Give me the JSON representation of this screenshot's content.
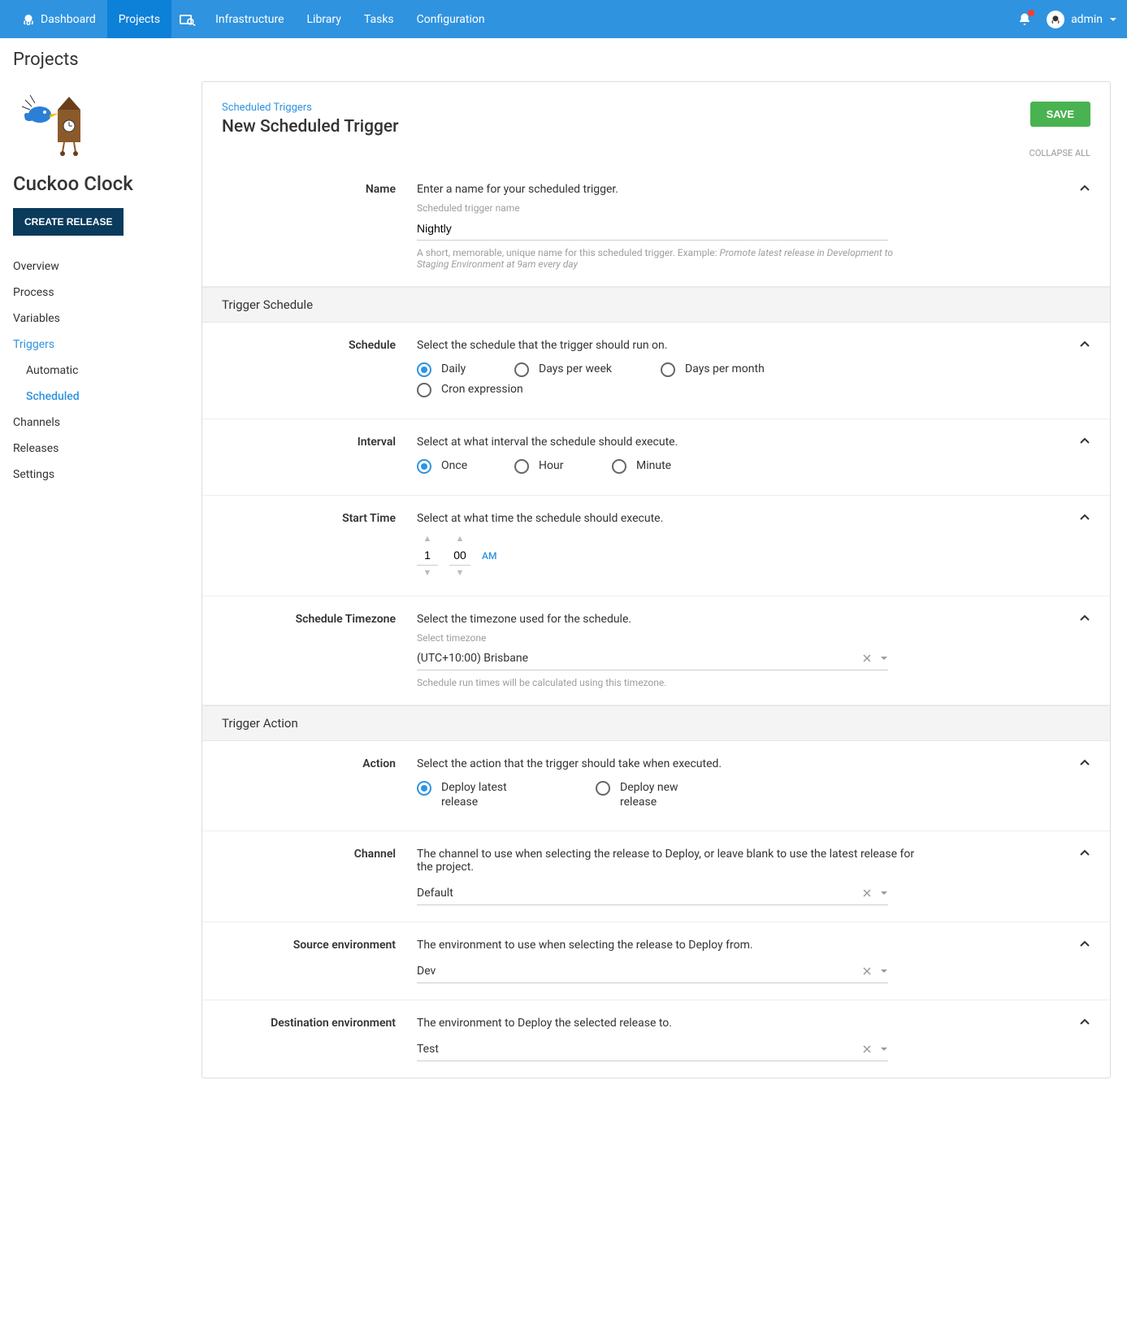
{
  "topnav": {
    "items": [
      "Dashboard",
      "Projects",
      "Infrastructure",
      "Library",
      "Tasks",
      "Configuration"
    ],
    "active": "Projects",
    "user": "admin"
  },
  "page_title": "Projects",
  "project": {
    "name": "Cuckoo Clock",
    "create_release_label": "CREATE RELEASE"
  },
  "sidebar": {
    "items": [
      {
        "label": "Overview"
      },
      {
        "label": "Process"
      },
      {
        "label": "Variables"
      },
      {
        "label": "Triggers",
        "active": true
      },
      {
        "label": "Automatic",
        "sub": true
      },
      {
        "label": "Scheduled",
        "sub": true,
        "active": true
      },
      {
        "label": "Channels"
      },
      {
        "label": "Releases"
      },
      {
        "label": "Settings"
      }
    ]
  },
  "header": {
    "breadcrumb": "Scheduled Triggers",
    "title": "New Scheduled Trigger",
    "save_label": "SAVE",
    "collapse_label": "COLLAPSE ALL"
  },
  "sections": {
    "name": {
      "label": "Name",
      "desc": "Enter a name for your scheduled trigger.",
      "hint": "Scheduled trigger name",
      "value": "Nightly",
      "help_prefix": "A short, memorable, unique name for this scheduled trigger. Example: ",
      "help_example": "Promote latest release in Development to Staging Environment at 9am every day"
    },
    "trigger_schedule_header": "Trigger Schedule",
    "schedule": {
      "label": "Schedule",
      "desc": "Select the schedule that the trigger should run on.",
      "options": [
        "Daily",
        "Days per week",
        "Days per month",
        "Cron expression"
      ],
      "selected": "Daily"
    },
    "interval": {
      "label": "Interval",
      "desc": "Select at what interval the schedule should execute.",
      "options": [
        "Once",
        "Hour",
        "Minute"
      ],
      "selected": "Once"
    },
    "start_time": {
      "label": "Start Time",
      "desc": "Select at what time the schedule should execute.",
      "hour": "1",
      "minute": "00",
      "ampm": "AM"
    },
    "timezone": {
      "label": "Schedule Timezone",
      "desc": "Select the timezone used for the schedule.",
      "hint": "Select timezone",
      "value": "(UTC+10:00) Brisbane",
      "help": "Schedule run times will be calculated using this timezone."
    },
    "trigger_action_header": "Trigger Action",
    "action": {
      "label": "Action",
      "desc": "Select the action that the trigger should take when executed.",
      "options": [
        "Deploy latest release",
        "Deploy new release"
      ],
      "selected": "Deploy latest release"
    },
    "channel": {
      "label": "Channel",
      "desc": "The channel to use when selecting the release to Deploy, or leave blank to use the latest release for the project.",
      "value": "Default"
    },
    "source_env": {
      "label": "Source environment",
      "desc": "The environment to use when selecting the release to Deploy from.",
      "value": "Dev"
    },
    "dest_env": {
      "label": "Destination environment",
      "desc": "The environment to Deploy the selected release to.",
      "value": "Test"
    }
  }
}
